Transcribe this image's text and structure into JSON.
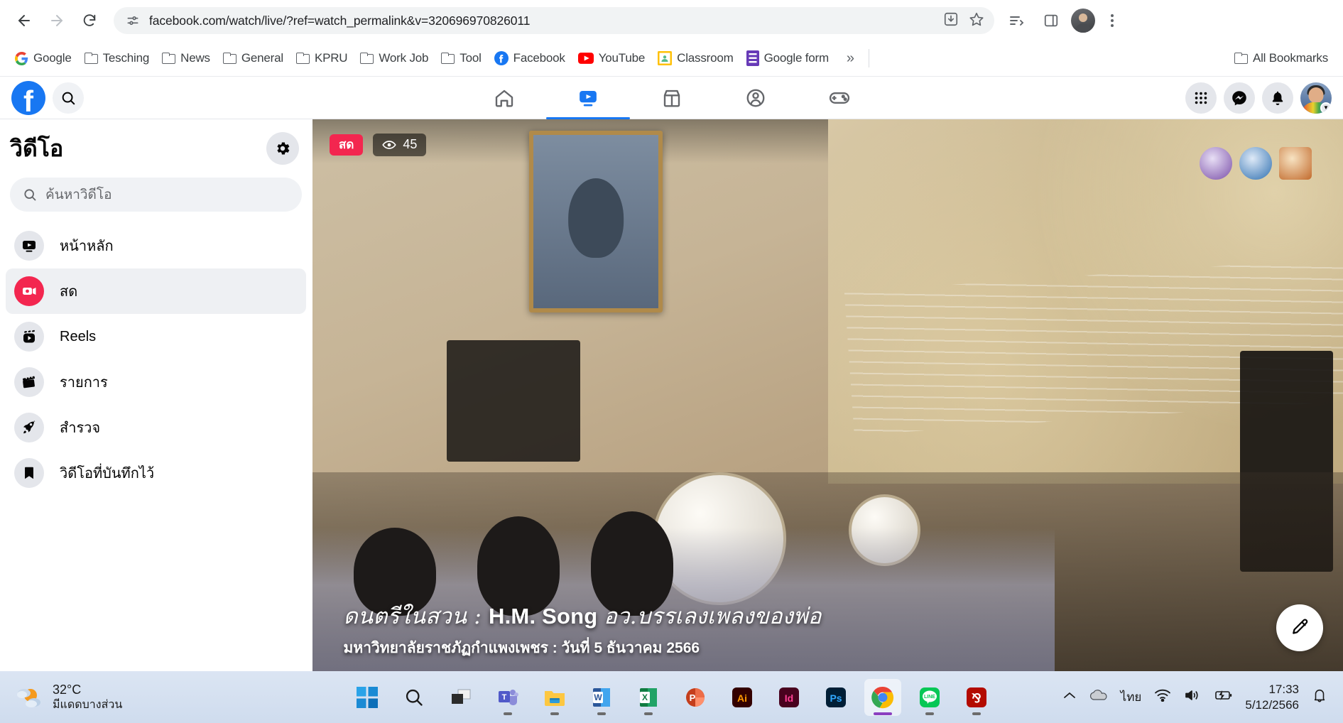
{
  "browser": {
    "url": "facebook.com/watch/live/?ref=watch_permalink&v=320696970826011",
    "back_label": "Back",
    "forward_label": "Forward",
    "reload_label": "Reload",
    "site_info_label": "site-settings",
    "install_label": "Install",
    "bookmark_star_label": "Bookmark this tab",
    "reading_list_label": "Reading list",
    "side_panel_label": "Side panel",
    "profile_label": "Profile",
    "menu_label": "Customize and control Chrome",
    "bookmarks": [
      {
        "label": "Google",
        "icon": "google-icon"
      },
      {
        "label": "Tesching",
        "icon": "folder-icon"
      },
      {
        "label": "News",
        "icon": "folder-icon"
      },
      {
        "label": "General",
        "icon": "folder-icon"
      },
      {
        "label": "KPRU",
        "icon": "folder-icon"
      },
      {
        "label": "Work Job",
        "icon": "folder-icon"
      },
      {
        "label": "Tool",
        "icon": "folder-icon"
      },
      {
        "label": "Facebook",
        "icon": "facebook-icon"
      },
      {
        "label": "YouTube",
        "icon": "youtube-icon"
      },
      {
        "label": "Classroom",
        "icon": "classroom-icon"
      },
      {
        "label": "Google form",
        "icon": "googleform-icon"
      }
    ],
    "overflow_label": "»",
    "all_bookmarks_label": "All Bookmarks"
  },
  "facebook": {
    "logo_letter": "f",
    "search_label": "search-icon",
    "tabs": [
      {
        "name": "home",
        "label": "Home",
        "active": false
      },
      {
        "name": "video",
        "label": "Video",
        "active": true
      },
      {
        "name": "marketplace",
        "label": "Marketplace",
        "active": false
      },
      {
        "name": "groups",
        "label": "Groups",
        "active": false
      },
      {
        "name": "gaming",
        "label": "Gaming",
        "active": false
      }
    ],
    "right_actions": [
      {
        "name": "menu-grid",
        "label": "Menu"
      },
      {
        "name": "messenger",
        "label": "Messenger"
      },
      {
        "name": "notifications",
        "label": "Notifications"
      },
      {
        "name": "account",
        "label": "Account"
      }
    ],
    "sidebar": {
      "title": "วิดีโอ",
      "settings_label": "gear-icon",
      "search_placeholder": "ค้นหาวิดีโอ",
      "items": [
        {
          "label": "หน้าหลัก",
          "icon": "video-home-icon",
          "active": false
        },
        {
          "label": "สด",
          "icon": "live-video-icon",
          "active": true
        },
        {
          "label": "Reels",
          "icon": "reels-icon",
          "active": false
        },
        {
          "label": "รายการ",
          "icon": "clapperboard-icon",
          "active": false
        },
        {
          "label": "สำรวจ",
          "icon": "rocket-icon",
          "active": false
        },
        {
          "label": "วิดีโอที่บันทึกไว้",
          "icon": "bookmark-icon",
          "active": false
        }
      ]
    },
    "player": {
      "live_badge": "สด",
      "viewer_icon": "eye-icon",
      "viewer_count": "45",
      "caption_line1_a": "ดนตรีในสวน : ",
      "caption_line1_b": "H.M. Song ",
      "caption_line1_c": "อว.บรรเลงเพลงของพ่อ",
      "caption_line2": "มหาวิทยาลัยราชภัฏกำแพงเพชร : วันที่ 5 ธันวาคม 2566",
      "compose_label": "compose-icon"
    }
  },
  "taskbar": {
    "weather_temp": "32°C",
    "weather_desc": "มีแดดบางส่วน",
    "apps": [
      {
        "name": "start",
        "label": "Start"
      },
      {
        "name": "search",
        "label": "Search"
      },
      {
        "name": "task-view",
        "label": "Task View"
      },
      {
        "name": "teams",
        "label": "Microsoft Teams"
      },
      {
        "name": "file-explorer",
        "label": "File Explorer"
      },
      {
        "name": "word",
        "label": "Word"
      },
      {
        "name": "excel",
        "label": "Excel"
      },
      {
        "name": "powerpoint",
        "label": "PowerPoint"
      },
      {
        "name": "illustrator",
        "label": "Ai"
      },
      {
        "name": "indesign",
        "label": "Id"
      },
      {
        "name": "photoshop",
        "label": "Ps"
      },
      {
        "name": "chrome",
        "label": "Google Chrome"
      },
      {
        "name": "line",
        "label": "LINE"
      },
      {
        "name": "acrobat",
        "label": "Adobe Acrobat"
      }
    ],
    "tray": {
      "show_hidden_label": "^",
      "cloud_label": "onedrive-icon",
      "language": "ไทย",
      "wifi_label": "wifi-icon",
      "volume_label": "volume-icon",
      "battery_label": "battery-charging-icon",
      "time": "17:33",
      "date": "5/12/2566",
      "notifications_label": "bell-icon"
    }
  },
  "colors": {
    "fb_blue": "#1877f2",
    "live_red": "#f3264f",
    "chrome_gray": "#f1f3f4",
    "taskbar": "#d6e2f2"
  }
}
